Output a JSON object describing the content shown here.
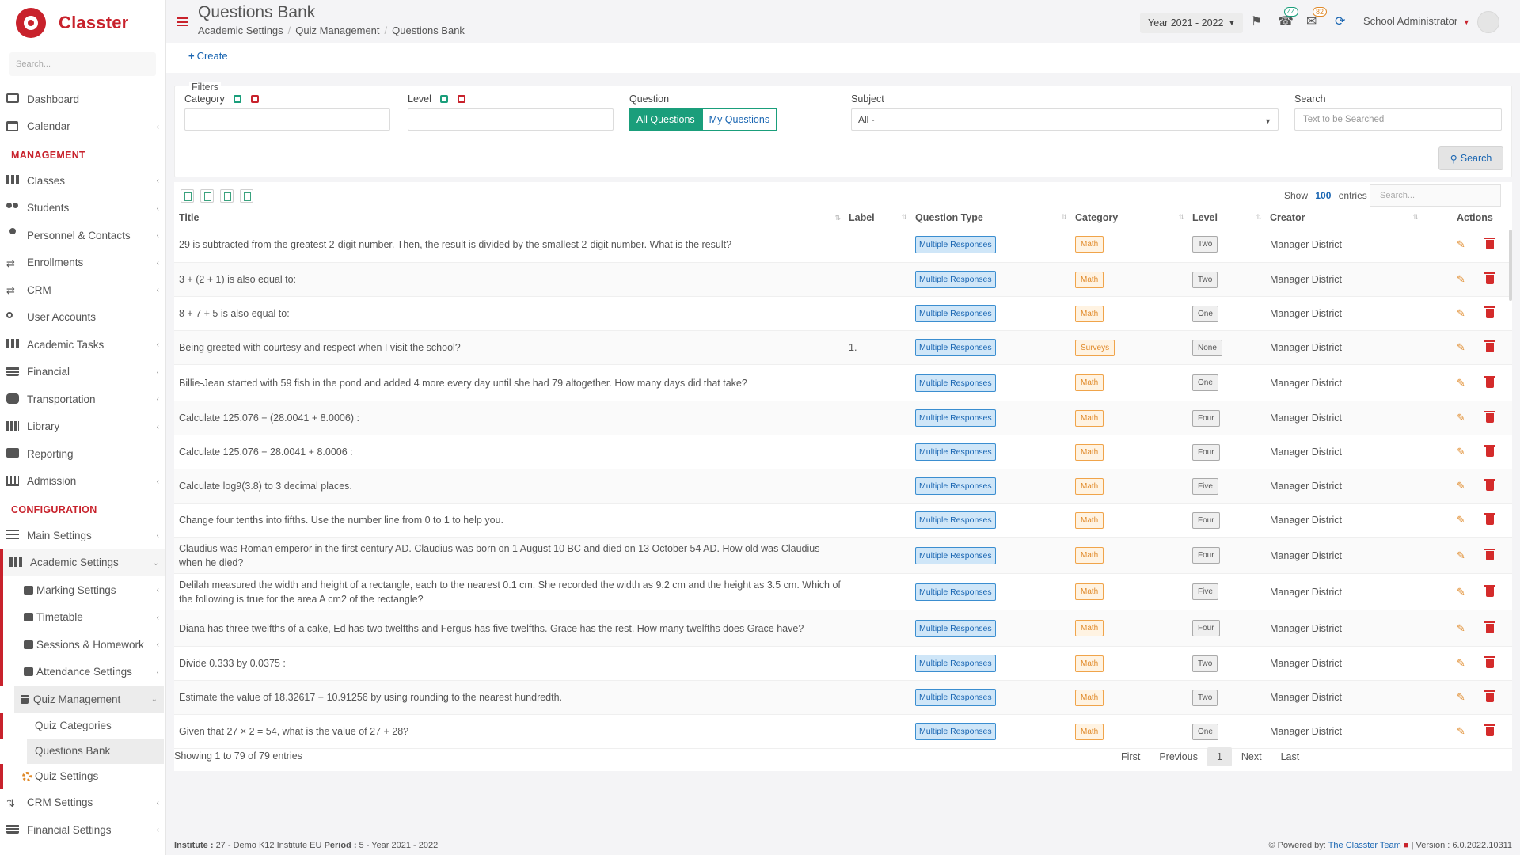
{
  "brand": {
    "name": "Classter"
  },
  "sidebar": {
    "search_placeholder": "Search...",
    "items_top": [
      {
        "label": "Dashboard",
        "icon": "monitor-icon"
      },
      {
        "label": "Calendar",
        "icon": "calendar-icon"
      }
    ],
    "management_title": "MANAGEMENT",
    "management": [
      {
        "label": "Classes",
        "icon": "classes-icon"
      },
      {
        "label": "Students",
        "icon": "students-icon"
      },
      {
        "label": "Personnel & Contacts",
        "icon": "personnel-icon"
      },
      {
        "label": "Enrollments",
        "icon": "enrollments-icon"
      },
      {
        "label": "CRM",
        "icon": "crm-icon"
      },
      {
        "label": "User Accounts",
        "icon": "key-icon"
      },
      {
        "label": "Academic Tasks",
        "icon": "tasks-icon"
      },
      {
        "label": "Financial",
        "icon": "financial-icon"
      },
      {
        "label": "Transportation",
        "icon": "bus-icon"
      },
      {
        "label": "Library",
        "icon": "library-icon"
      },
      {
        "label": "Reporting",
        "icon": "printer-icon"
      },
      {
        "label": "Admission",
        "icon": "bank-icon"
      }
    ],
    "configuration_title": "CONFIGURATION",
    "main_settings": "Main Settings",
    "academic_settings": "Academic Settings",
    "academic_sub": [
      {
        "label": "Marking Settings"
      },
      {
        "label": "Timetable"
      },
      {
        "label": "Sessions & Homework"
      },
      {
        "label": "Attendance Settings"
      }
    ],
    "quiz_management": "Quiz Management",
    "quiz_sub": [
      {
        "label": "Quiz Categories"
      },
      {
        "label": "Questions Bank"
      },
      {
        "label": "Quiz Settings"
      }
    ],
    "crm_settings": "CRM Settings",
    "financial_settings": "Financial Settings"
  },
  "header": {
    "title": "Questions Bank",
    "breadcrumb": [
      "Academic Settings",
      "Quiz Management",
      "Questions Bank"
    ],
    "year": "Year 2021 - 2022",
    "notifications_count": "44",
    "messages_count": "82",
    "user": "School Administrator"
  },
  "toolbar": {
    "create_label": "Create"
  },
  "filters": {
    "legend": "Filters",
    "category_label": "Category",
    "level_label": "Level",
    "question_label": "Question",
    "question_options": [
      "All Questions",
      "My Questions"
    ],
    "subject_label": "Subject",
    "subject_value": "All -",
    "search_label": "Search",
    "search_placeholder": "Text to be Searched",
    "search_button": "Search"
  },
  "table": {
    "show_label": "Show",
    "page_size": "100",
    "entries_label": "entries",
    "search_placeholder": "Search...",
    "columns": [
      "Title",
      "Label",
      "Question Type",
      "Category",
      "Level",
      "Creator",
      "Actions"
    ],
    "rows": [
      {
        "title": "29 is subtracted from the greatest 2-digit number. Then, the result is divided by the smallest 2-digit number. What is the result?",
        "label": "",
        "type": "Multiple Responses",
        "category": "Math",
        "level": "Two",
        "creator": "Manager District"
      },
      {
        "title": "3 + (2 + 1) is also equal to:",
        "label": "",
        "type": "Multiple Responses",
        "category": "Math",
        "level": "Two",
        "creator": "Manager District"
      },
      {
        "title": "8 + 7 + 5 is also equal to:",
        "label": "",
        "type": "Multiple Responses",
        "category": "Math",
        "level": "One",
        "creator": "Manager District"
      },
      {
        "title": "Being greeted with courtesy and respect when I visit the school?",
        "label": "1.",
        "type": "Multiple Responses",
        "category": "Surveys",
        "level": "None",
        "creator": "Manager District"
      },
      {
        "title": "Billie-Jean started with 59 fish in the pond and added 4 more every day until she had 79 altogether. How many days did that take?",
        "label": "",
        "type": "Multiple Responses",
        "category": "Math",
        "level": "One",
        "creator": "Manager District"
      },
      {
        "title": "Calculate 125.076 − (28.0041 + 8.0006) :",
        "label": "",
        "type": "Multiple Responses",
        "category": "Math",
        "level": "Four",
        "creator": "Manager District"
      },
      {
        "title": "Calculate 125.076 − 28.0041 + 8.0006 :",
        "label": "",
        "type": "Multiple Responses",
        "category": "Math",
        "level": "Four",
        "creator": "Manager District"
      },
      {
        "title": "Calculate log9(3.8) to 3 decimal places.",
        "label": "",
        "type": "Multiple Responses",
        "category": "Math",
        "level": "Five",
        "creator": "Manager District"
      },
      {
        "title": "Change four tenths into fifths. Use the number line from 0 to 1 to help you.",
        "label": "",
        "type": "Multiple Responses",
        "category": "Math",
        "level": "Four",
        "creator": "Manager District"
      },
      {
        "title": "Claudius was Roman emperor in the first century AD. Claudius was born on 1 August 10 BC and died on 13 October 54 AD. How old was Claudius when he died?",
        "label": "",
        "type": "Multiple Responses",
        "category": "Math",
        "level": "Four",
        "creator": "Manager District"
      },
      {
        "title": "Delilah measured the width and height of a rectangle, each to the nearest 0.1 cm. She recorded the width as 9.2 cm and the height as 3.5 cm. Which of the following is true for the area A cm2 of the rectangle?",
        "label": "",
        "type": "Multiple Responses",
        "category": "Math",
        "level": "Five",
        "creator": "Manager District"
      },
      {
        "title": "Diana has three twelfths of a cake, Ed has two twelfths and Fergus has five twelfths. Grace has the rest. How many twelfths does Grace have?",
        "label": "",
        "type": "Multiple Responses",
        "category": "Math",
        "level": "Four",
        "creator": "Manager District"
      },
      {
        "title": "Divide 0.333 by 0.0375 :",
        "label": "",
        "type": "Multiple Responses",
        "category": "Math",
        "level": "Two",
        "creator": "Manager District"
      },
      {
        "title": "Estimate the value of 18.32617 − 10.91256 by using rounding to the nearest hundredth.",
        "label": "",
        "type": "Multiple Responses",
        "category": "Math",
        "level": "Two",
        "creator": "Manager District"
      },
      {
        "title": "Given that 27 × 2 = 54, what is the value of 27 + 28?",
        "label": "",
        "type": "Multiple Responses",
        "category": "Math",
        "level": "One",
        "creator": "Manager District"
      }
    ],
    "info": "Showing 1 to 79 of 79 entries",
    "pager": [
      "First",
      "Previous",
      "1",
      "Next",
      "Last"
    ]
  },
  "footer": {
    "institute_label": "Institute :",
    "institute_value": "27 - Demo K12 Institute EU",
    "period_label": "Period :",
    "period_value": "5 - Year 2021 - 2022",
    "powered_label": "Powered by:",
    "powered_link": "The Classter Team",
    "version": "| Version : 6.0.2022.10311"
  },
  "colors": {
    "brand": "#c8222c",
    "link": "#1a66b2",
    "accent": "#1a9e7b",
    "math": "#e08a2a"
  }
}
